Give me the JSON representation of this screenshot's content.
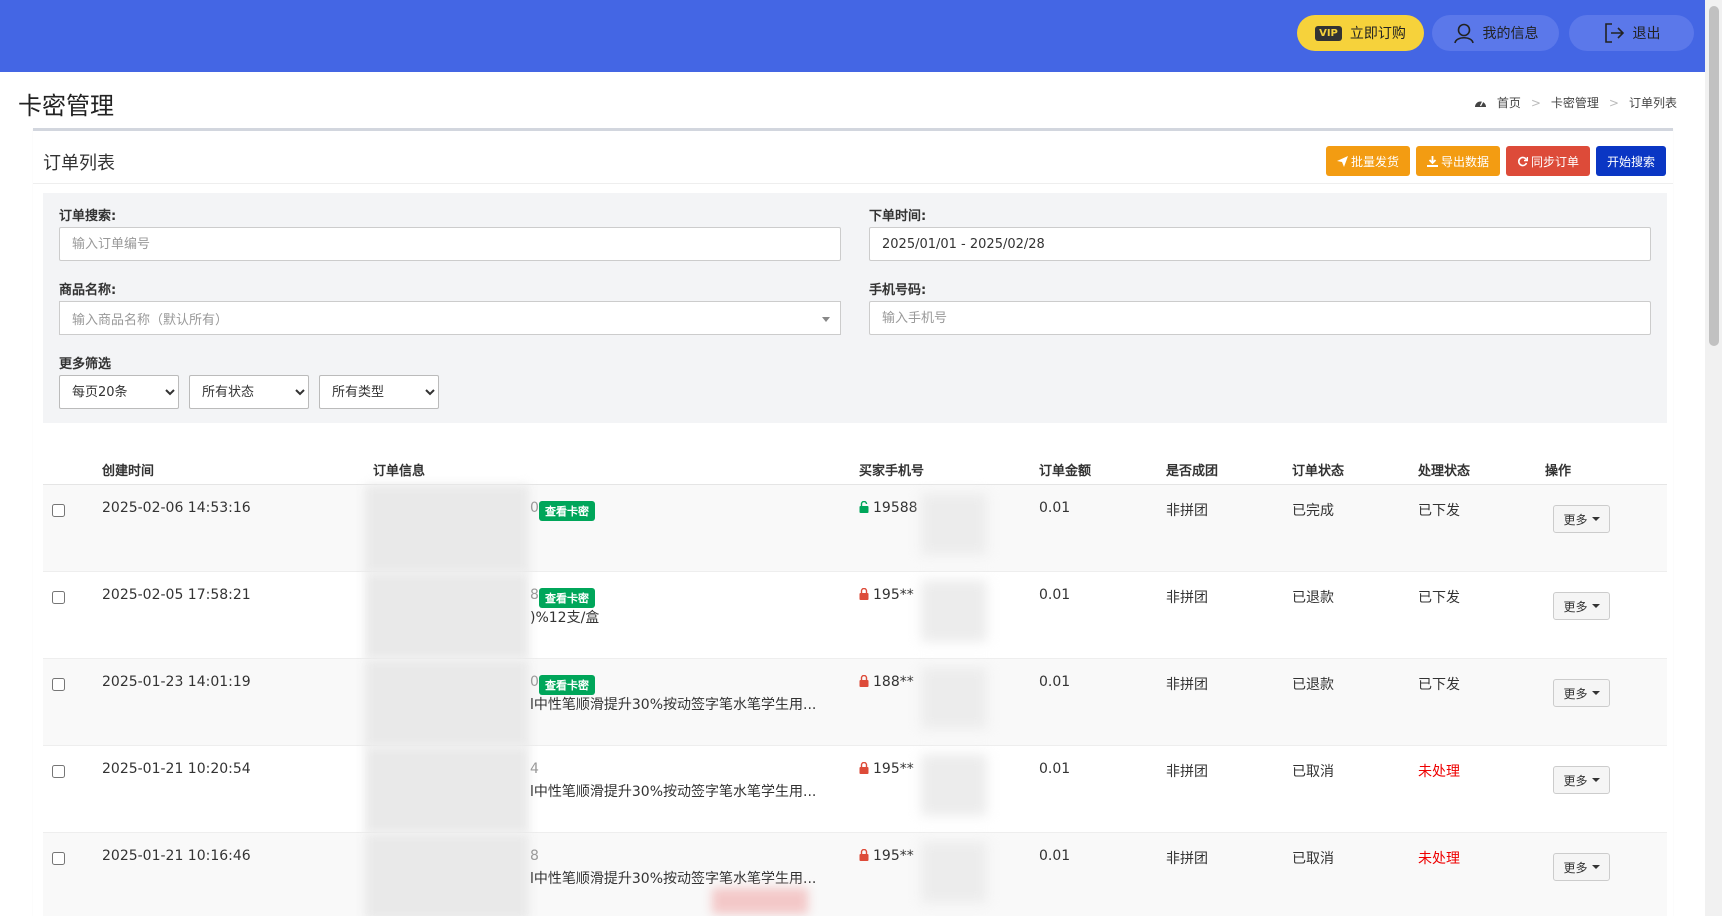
{
  "header": {
    "vip_badge": "VIP",
    "subscribe_label": "立即订购",
    "myinfo_label": "我的信息",
    "logout_label": "退出",
    "bar_color": "#4466e4"
  },
  "page": {
    "title": "卡密管理",
    "breadcrumb": [
      "首页",
      "卡密管理",
      "订单列表"
    ]
  },
  "panel": {
    "title": "订单列表",
    "actions": [
      {
        "label": "批量发货",
        "color": "#f39c12"
      },
      {
        "label": "导出数据",
        "color": "#f39c12"
      },
      {
        "label": "同步订单",
        "color": "#dd4b39"
      },
      {
        "label": "开始搜索",
        "color": "#0a36c4"
      }
    ]
  },
  "filters": {
    "order_label": "订单搜索:",
    "order_placeholder": "输入订单编号",
    "time_label": "下单时间:",
    "time_value": "2025/01/01 - 2025/02/28",
    "product_label": "商品名称:",
    "product_placeholder": "输入商品名称（默认所有）",
    "phone_label": "手机号码:",
    "phone_placeholder": "输入手机号",
    "more_label": "更多筛选",
    "per_page": "每页20条",
    "status": "所有状态",
    "type": "所有类型"
  },
  "table": {
    "headers": [
      "创建时间",
      "订单信息",
      "买家手机号",
      "订单金额",
      "是否成团",
      "订单状态",
      "处理状态",
      "操作"
    ],
    "view_card_label": "查看卡密",
    "more_label": "更多",
    "rows": [
      {
        "time": "2025-02-06 14:53:16",
        "order_tail": "0",
        "has_card": true,
        "desc": "",
        "lock": "open",
        "phone": "19588",
        "amount": "0.01",
        "group": "非拼团",
        "status": "已完成",
        "process": "已下发",
        "process_red": false
      },
      {
        "time": "2025-02-05 17:58:21",
        "order_tail": "8",
        "has_card": true,
        "desc": ")%12支/盒",
        "lock": "closed",
        "phone": "195**",
        "amount": "0.01",
        "group": "非拼团",
        "status": "已退款",
        "process": "已下发",
        "process_red": false
      },
      {
        "time": "2025-01-23 14:01:19",
        "order_tail": "0",
        "has_card": true,
        "desc": "l中性笔顺滑提升30%按动签字笔水笔学生用...",
        "lock": "closed",
        "phone": "188**",
        "amount": "0.01",
        "group": "非拼团",
        "status": "已退款",
        "process": "已下发",
        "process_red": false
      },
      {
        "time": "2025-01-21 10:20:54",
        "order_tail": "4",
        "has_card": false,
        "desc": "l中性笔顺滑提升30%按动签字笔水笔学生用...",
        "lock": "closed",
        "phone": "195**",
        "amount": "0.01",
        "group": "非拼团",
        "status": "已取消",
        "process": "未处理",
        "process_red": true
      },
      {
        "time": "2025-01-21 10:16:46",
        "order_tail": "8",
        "has_card": false,
        "desc": "l中性笔顺滑提升30%按动签字笔水笔学生用...",
        "lock": "closed",
        "phone": "195**",
        "amount": "0.01",
        "group": "非拼团",
        "status": "已取消",
        "process": "未处理",
        "process_red": true
      }
    ]
  }
}
